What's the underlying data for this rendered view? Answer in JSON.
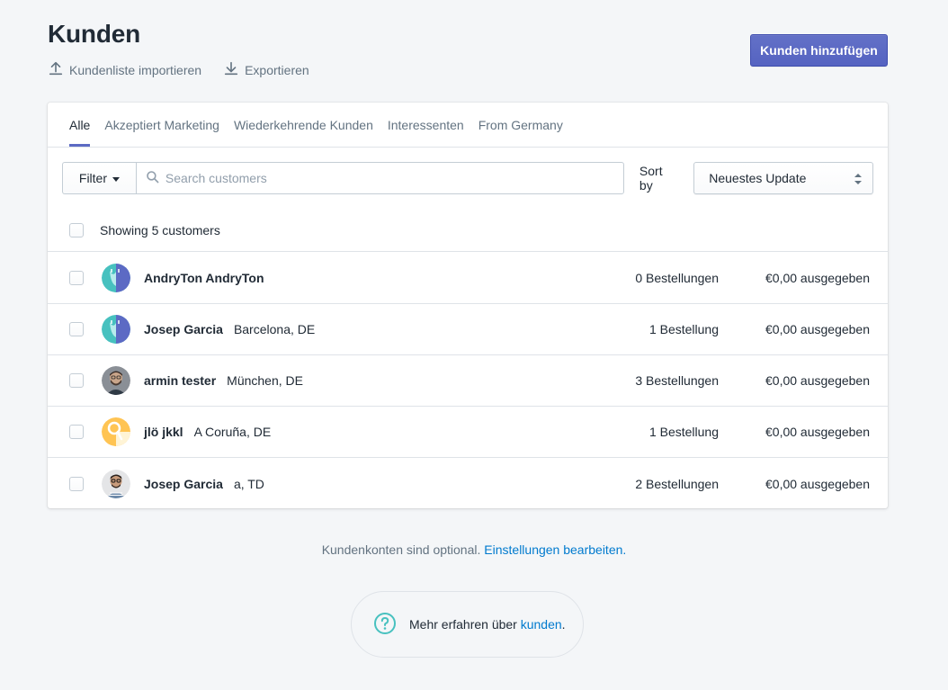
{
  "page": {
    "title": "Kunden",
    "import_label": "Kundenliste importieren",
    "export_label": "Exportieren",
    "add_button": "Kunden hinzufügen"
  },
  "tabs": [
    {
      "label": "Alle",
      "active": true
    },
    {
      "label": "Akzeptiert Marketing",
      "active": false
    },
    {
      "label": "Wiederkehrende Kunden",
      "active": false
    },
    {
      "label": "Interessenten",
      "active": false
    },
    {
      "label": "From Germany",
      "active": false
    }
  ],
  "toolbar": {
    "filter_label": "Filter",
    "search_placeholder": "Search customers",
    "search_value": "",
    "sort_label": "Sort by",
    "sort_value": "Neuestes Update"
  },
  "list": {
    "showing_text": "Showing 5 customers"
  },
  "customers": [
    {
      "name": "AndryTon AndryTon",
      "location": "",
      "orders": "0 Bestellungen",
      "spent": "€0,00 ausgegeben",
      "avatar": "teal-shopping-bag-avatar"
    },
    {
      "name": "Josep Garcia",
      "location": "Barcelona, DE",
      "orders": "1 Bestellung",
      "spent": "€0,00 ausgegeben",
      "avatar": "teal-shopping-bag-avatar"
    },
    {
      "name": "armin tester",
      "location": "München, DE",
      "orders": "3 Bestellungen",
      "spent": "€0,00 ausgegeben",
      "avatar": "photo-avatar-bearded-man"
    },
    {
      "name": "jlö jkkl",
      "location": "A Coruña, DE",
      "orders": "1 Bestellung",
      "spent": "€0,00 ausgegeben",
      "avatar": "yellow-magnifier-avatar"
    },
    {
      "name": "Josep Garcia",
      "location": "a, TD",
      "orders": "2 Bestellungen",
      "spent": "€0,00 ausgegeben",
      "avatar": "photo-avatar-man-glasses"
    }
  ],
  "footer": {
    "note_text": "Kundenkonten sind optional.",
    "note_link": "Einstellungen bearbeiten.",
    "help_text": "Mehr erfahren über",
    "help_link": "kunden",
    "help_suffix": "."
  },
  "colors": {
    "primary": "#5c6ac4",
    "link": "#007ace",
    "help_icon": "#47c1bf",
    "background": "#f4f6f8"
  }
}
